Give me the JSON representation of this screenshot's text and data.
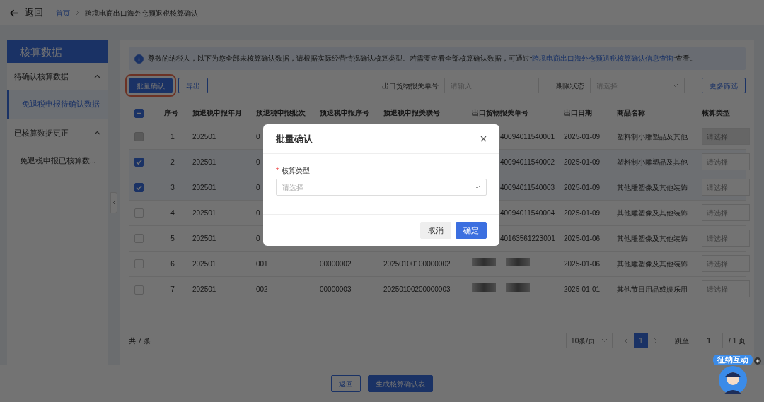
{
  "header": {
    "back": "返回",
    "breadcrumb": [
      {
        "label": "首页",
        "link": true
      },
      {
        "label": "跨境电商出口海外仓预退税核算确认",
        "link": false
      }
    ]
  },
  "sidebar": {
    "title": "核算数据",
    "groups": [
      {
        "label": "待确认核算数据",
        "expanded": true,
        "children": [
          {
            "label": "免退税申报待确认数据",
            "selected": true
          }
        ]
      },
      {
        "label": "已核算数据更正",
        "expanded": true,
        "children": [
          {
            "label": "免退税申报已核算数...",
            "selected": false
          }
        ]
      }
    ]
  },
  "notice": {
    "before": "尊敬的纳税人，以下为您全部未核算确认数据，请根据实际经营情况确认核算类型。若需要查看全部核算确认数据，可通过“",
    "link": "跨境电商出口海外仓预退税核算确认信息查询",
    "after": "”查看。"
  },
  "toolbar": {
    "buttons": [
      {
        "label": "批量确认",
        "kind": "primary",
        "annotated": true
      },
      {
        "label": "导出",
        "kind": "outline",
        "annotated": false
      }
    ],
    "filters": [
      {
        "label": "出口货物报关单号",
        "placeholder": "请输入",
        "kind": "input"
      },
      {
        "label": "期限状态",
        "placeholder": "请选择",
        "kind": "select"
      }
    ],
    "more": "更多筛选"
  },
  "table": {
    "select_all": {
      "indeterminate": true
    },
    "columns": [
      "序号",
      "预退税申报年月",
      "预退税申报批次",
      "预退税申报序号",
      "预退税申报关联号",
      "出口货物报关单号",
      "出口日期",
      "商品名称",
      "核算类型"
    ],
    "rows": [
      {
        "checked": false,
        "disabled": true,
        "no": "1",
        "month": "202501",
        "batch": "0",
        "customs_no": "40094011540001",
        "date": "2025-01-09",
        "goods": "塑料制小雕塑品及其他",
        "type_placeholder": "请选择"
      },
      {
        "checked": true,
        "disabled": false,
        "no": "2",
        "month": "202501",
        "batch": "0",
        "customs_no": "40094011540002",
        "date": "2025-01-09",
        "goods": "塑料制小雕塑品及其他",
        "type_placeholder": "请选择"
      },
      {
        "checked": true,
        "disabled": false,
        "no": "3",
        "month": "202501",
        "batch": "0",
        "customs_no": "40094011540003",
        "date": "2025-01-09",
        "goods": "其他雕塑像及其他装饰",
        "type_placeholder": "请选择"
      },
      {
        "checked": false,
        "disabled": false,
        "no": "4",
        "month": "202501",
        "batch": "0",
        "customs_no": "40094011540004",
        "date": "2025-01-09",
        "goods": "其他雕塑像及其他装饰",
        "type_placeholder": "请选择"
      },
      {
        "checked": false,
        "disabled": false,
        "no": "5",
        "month": "202501",
        "batch": "0",
        "customs_no": "40163561223001",
        "date": "2025-01-06",
        "goods": "其他雕塑像及其他装饰",
        "type_placeholder": "请选择"
      },
      {
        "checked": false,
        "disabled": false,
        "no": "6",
        "month": "202501",
        "batch": "001",
        "serial": "00000002",
        "link_no": "20250100100000002",
        "customs_masked": true,
        "date": "2025-01-06",
        "goods": "其他雕塑像及其他装饰",
        "type_placeholder": "请选择"
      },
      {
        "checked": false,
        "disabled": false,
        "no": "7",
        "month": "202501",
        "batch": "002",
        "serial": "00000003",
        "link_no": "20250100200000003",
        "customs_masked": true,
        "date": "2025-01-01",
        "goods": "其他节日用品或娱乐用",
        "type_placeholder": "请选择"
      }
    ]
  },
  "pagination": {
    "total": "共 7 条",
    "page_size": "10条/页",
    "pages": [
      {
        "label": "1",
        "selected": true
      }
    ],
    "jump_label": "跳至",
    "jump_value": "1",
    "page_total": "/ 1 页"
  },
  "footer": {
    "buttons": [
      {
        "label": "返回",
        "kind": "outline"
      },
      {
        "label": "生成核算确认表",
        "kind": "primary"
      }
    ]
  },
  "modal": {
    "title": "批量确认",
    "field": {
      "required_marker": "*",
      "label": "核算类型",
      "placeholder": "请选择"
    },
    "buttons": [
      {
        "label": "取消",
        "kind": "secondary"
      },
      {
        "label": "确定",
        "kind": "primary"
      }
    ]
  },
  "widget": {
    "label": "征纳互动"
  }
}
